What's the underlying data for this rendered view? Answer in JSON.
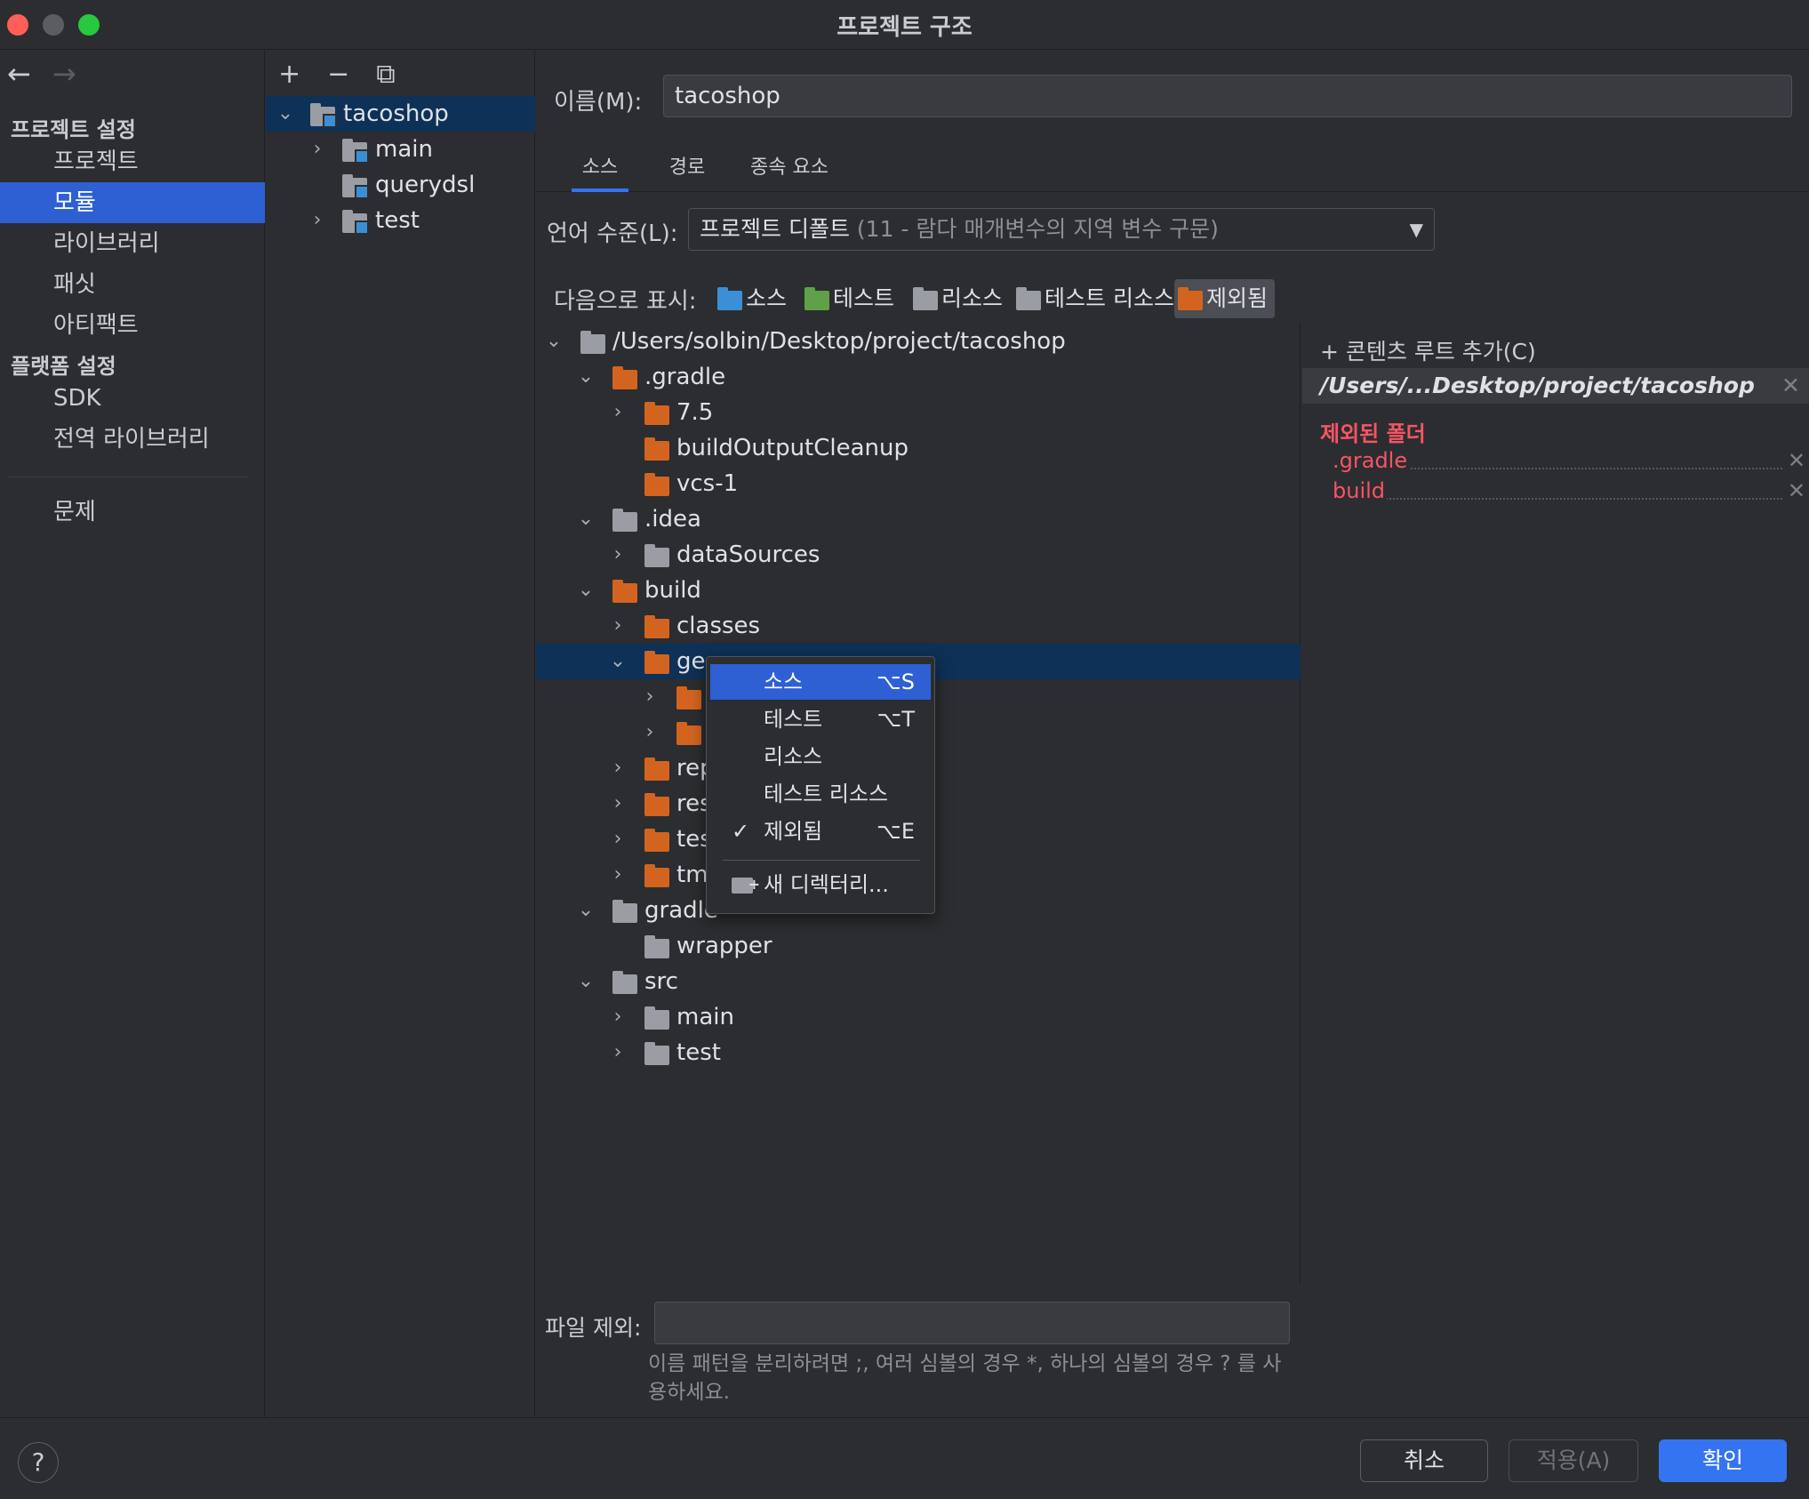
{
  "window": {
    "title": "프로젝트 구조"
  },
  "nav": {
    "back_icon": "arrow-left-icon",
    "forward_icon": "arrow-right-icon",
    "section_project": "프로젝트 설정",
    "project_items": [
      "프로젝트",
      "모듈",
      "라이브러리",
      "패싯",
      "아티팩트"
    ],
    "section_platform": "플랫폼 설정",
    "platform_items": [
      "SDK",
      "전역 라이브러리"
    ],
    "problems": "문제",
    "selected": "모듈"
  },
  "modules": {
    "toolbar": [
      "+",
      "−",
      "⧉"
    ],
    "tree": [
      {
        "label": "tacoshop",
        "expanded": true,
        "selected": true
      },
      {
        "label": "main",
        "expanded": false
      },
      {
        "label": "querydsl"
      },
      {
        "label": "test",
        "expanded": false
      }
    ]
  },
  "main": {
    "name_label": "이름(M):",
    "name_value": "tacoshop",
    "tabs": [
      "소스",
      "경로",
      "종속 요소"
    ],
    "active_tab": "소스",
    "lang_label": "언어 수준(L):",
    "lang_value": "프로젝트 디폴트",
    "lang_hint": "(11 - 람다 매개변수의 지역 변수 구문)",
    "mark_label": "다음으로 표시:",
    "mark_items": [
      "소스",
      "테스트",
      "리소스",
      "테스트 리소스",
      "제외됨"
    ],
    "exclude_label": "파일 제외:",
    "exclude_value": "",
    "exclude_hint": "이름 패턴을 분리하려면 ;, 여러 심볼의 경우 *, 하나의 심볼의 경우 ? 를 사용하세요."
  },
  "tree": [
    {
      "label": "/Users/solbin/Desktop/project/tacoshop",
      "color": "gray"
    },
    {
      "label": ".gradle",
      "color": "orange"
    },
    {
      "label": "7.5",
      "color": "orange"
    },
    {
      "label": "buildOutputCleanup",
      "color": "orange"
    },
    {
      "label": "vcs-1",
      "color": "orange"
    },
    {
      "label": ".idea",
      "color": "gray"
    },
    {
      "label": "dataSources",
      "color": "gray"
    },
    {
      "label": "build",
      "color": "orange"
    },
    {
      "label": "classes",
      "color": "orange"
    },
    {
      "label": "ge",
      "color": "orange",
      "selected": true
    },
    {
      "label": "",
      "color": "orange"
    },
    {
      "label": "",
      "color": "orange"
    },
    {
      "label": "rep",
      "color": "orange"
    },
    {
      "label": "res",
      "color": "orange"
    },
    {
      "label": "tes",
      "color": "orange"
    },
    {
      "label": "tm",
      "color": "orange"
    },
    {
      "label": "gradle",
      "color": "gray"
    },
    {
      "label": "wrapper",
      "color": "gray"
    },
    {
      "label": "src",
      "color": "gray"
    },
    {
      "label": "main",
      "color": "gray"
    },
    {
      "label": "test",
      "color": "gray"
    }
  ],
  "root_panel": {
    "add_root": "+ 콘텐츠 루트 추가(C)",
    "root_path": "/Users/...Desktop/project/tacoshop",
    "excluded_title": "제외된 폴더",
    "excluded": [
      ".gradle",
      "build"
    ],
    "close_icon": "close-icon"
  },
  "popup": {
    "items": [
      {
        "label": "소스",
        "shortcut": "⌥S",
        "active": true
      },
      {
        "label": "테스트",
        "shortcut": "⌥T"
      },
      {
        "label": "리소스",
        "shortcut": ""
      },
      {
        "label": "테스트 리소스",
        "shortcut": ""
      },
      {
        "label": "제외됨",
        "shortcut": "⌥E",
        "checked": true
      }
    ],
    "new_dir": "새 디렉터리..."
  },
  "buttons": {
    "help": "?",
    "cancel": "취소",
    "apply": "적용(A)",
    "ok": "확인"
  },
  "colors": {
    "accent": "#3574f0",
    "selection": "#2e5fd3",
    "excluded": "#f75464",
    "orange_folder": "#d3641f"
  }
}
